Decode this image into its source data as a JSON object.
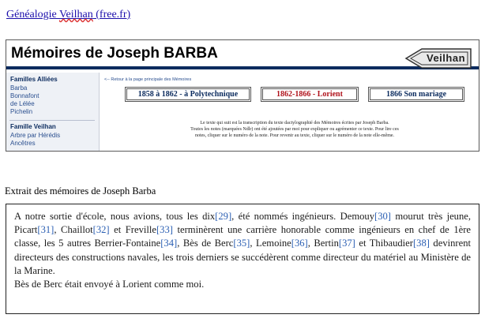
{
  "top_link": {
    "prefix": "Généalogie ",
    "squiggle": "Veilhan",
    "suffix": " (free.fr)"
  },
  "screenshot": {
    "title": "Mémoires de Joseph BARBA",
    "sign_label": "Veilhan",
    "sidebar": {
      "section1_title": "Familles Alliées",
      "section1_items": [
        "Barba",
        "Bonnafont",
        "de Lélée",
        "Pichelin"
      ],
      "section2_title": "Famille Veilhan",
      "section2_items": [
        "Arbre par Hérédis",
        "Ancêtres"
      ]
    },
    "back_link": "<-- Retour à la page principale des Mémoires",
    "tabs": [
      {
        "label": "1858 à 1862 - à Polytechnique",
        "color": "#0b2b5e"
      },
      {
        "label": "1862-1866 - Lorient",
        "color": "#b0121b"
      },
      {
        "label": "1866 Son mariage",
        "color": "#0b2b5e"
      }
    ],
    "intro_lines": [
      "Le texte qui suit est la transcription du texte dactylographié des Mémoires écrites par Joseph Barba.",
      "Toutes les notes (marquées Ndlr) ont été ajoutées par moi pour expliquer ou agrémenter ce texte. Pour lire ces",
      "notes, cliquer sur le numéro de la note. Pour revenir au texte, cliquer sur le numéro de la note elle-même."
    ]
  },
  "extrait_heading": "Extrait des mémoires  de Joseph Barba",
  "excerpt": {
    "p1": "A notre sortie d'école, nous avions, tous les dix",
    "r29": "[29]",
    "p2": ", été nommés ingénieurs. Demouy",
    "r30": "[30]",
    "p3": " mourut très jeune, Picart",
    "r31": "[31]",
    "p4": ", Chaillot",
    "r32": "[32]",
    "p5": " et Freville",
    "r33": "[33]",
    "p6": " terminèrent une carrière honorable comme ingénieurs en chef de 1ère classe, les 5 autres Berrier-Fontaine",
    "r34": "[34]",
    "p7": ", Bès de Berc",
    "r35": "[35]",
    "p8": ", Lemoine",
    "r36": "[36]",
    "p9": ", Bertin",
    "r37": "[37]",
    "p10": " et Thibaudier",
    "r38": "[38]",
    "p11": " devinrent directeurs des constructions navales, les trois derniers se succédèrent comme directeur du matériel au Ministère de la Marine.",
    "last_line": "Bès de Berc était envoyé à Lorient comme moi."
  }
}
